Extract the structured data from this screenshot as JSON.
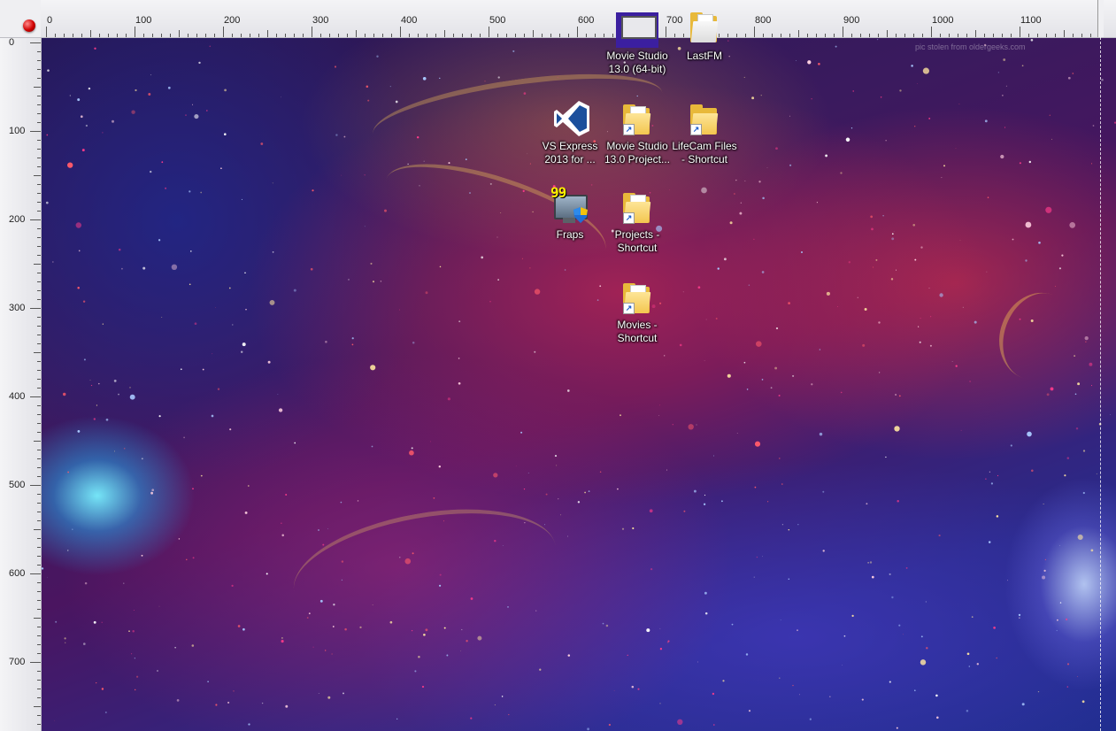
{
  "ruler": {
    "top_labels": [
      "0",
      "100",
      "200",
      "300",
      "400",
      "500",
      "600",
      "700",
      "800",
      "900",
      "1000",
      "1100"
    ],
    "left_labels": [
      "0",
      "100",
      "200",
      "300",
      "400",
      "500",
      "600",
      "700"
    ]
  },
  "watermark": "pic stolen from oldergeeks.com",
  "icons": [
    {
      "label": "Movie Studio 13.0 (64-bit)",
      "icon": "movie-studio-icon"
    },
    {
      "label": "LastFM",
      "icon": "folder-icon"
    },
    {
      "label": "VS Express 2013 for ...",
      "icon": "visual-studio-icon"
    },
    {
      "label": "Movie Studio 13.0 Project...",
      "icon": "folder-shortcut-icon"
    },
    {
      "label": "LifeCam Files - Shortcut",
      "icon": "folder-shortcut-icon"
    },
    {
      "label": "Fraps",
      "icon": "fraps-icon"
    },
    {
      "label": "Projects - Shortcut",
      "icon": "folder-shortcut-icon"
    },
    {
      "label": "Movies - Shortcut",
      "icon": "folder-shortcut-icon"
    }
  ],
  "colors": {
    "ruler_bg": "#e8e8ec",
    "knob": "#d00000",
    "folder": "#f3c64f",
    "vs_blue": "#1b4f9c"
  }
}
